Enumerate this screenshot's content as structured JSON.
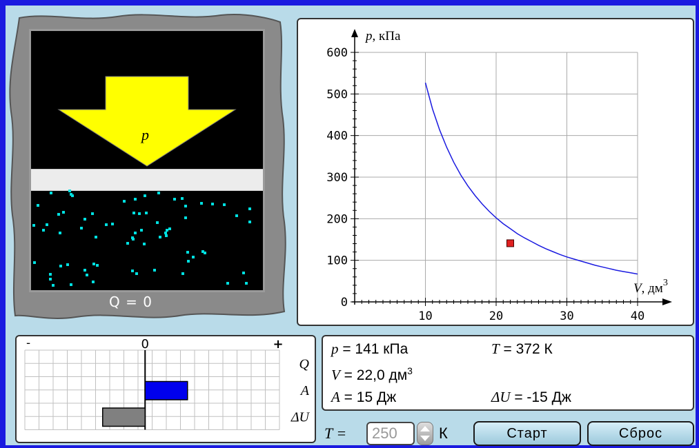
{
  "cylinder": {
    "arrow_label": "p",
    "heat_label": "Q = 0",
    "piston_level": 0.56
  },
  "graph": {
    "y_axis_label": "p, кПа",
    "x_axis_label_main": "V, дм",
    "x_axis_label_sup": "3",
    "colors": {
      "curve": "#1a1ae0",
      "marker": "#e02020"
    }
  },
  "chart_data": {
    "type": "line",
    "x_label": "V, дм3",
    "y_label": "p, кПа",
    "xlim": [
      0,
      40
    ],
    "ylim": [
      0,
      600
    ],
    "x_ticks": [
      10,
      20,
      30,
      40
    ],
    "y_ticks": [
      0,
      100,
      200,
      300,
      400,
      500,
      600
    ],
    "grid": true,
    "series": [
      {
        "x": [
          10,
          11,
          12,
          13,
          14,
          15,
          16,
          17,
          18,
          19,
          20,
          21,
          22,
          23,
          24,
          25,
          26,
          27,
          28,
          29,
          30,
          31,
          32,
          33,
          34,
          35,
          36,
          37,
          38,
          39,
          40
        ],
        "y": [
          527,
          464,
          414,
          372,
          336,
          305,
          279,
          256,
          236,
          218,
          202,
          188,
          176,
          164,
          154,
          145,
          136,
          128,
          121,
          114,
          108,
          103,
          98,
          93,
          88,
          84,
          80,
          76,
          73,
          70,
          67
        ]
      }
    ],
    "marker": {
      "x": 22,
      "y": 141
    }
  },
  "energy": {
    "scale_minus": "-",
    "scale_zero": "0",
    "scale_plus": "+",
    "rows": [
      {
        "label": "Q",
        "value": 0
      },
      {
        "label": "A",
        "value": 15
      },
      {
        "label": "ΔU",
        "value": -15
      }
    ],
    "colors": {
      "A": "#0000ee",
      "dU": "#808080"
    }
  },
  "readout": {
    "p_sym": "p",
    "p_val": " = 141 кПа",
    "T_sym": "T",
    "T_val": " = 372 К",
    "V_sym": "V",
    "V_val": " = 22,0 дм",
    "V_sup": "3",
    "A_sym": "A",
    "A_val": " =  15 Дж",
    "dU_sym": "ΔU",
    "dU_val": " =  -15 Дж"
  },
  "controls": {
    "t_label": "T =",
    "t_value": "250",
    "t_unit": "К",
    "start_label": "Старт",
    "reset_label": "Сброс"
  }
}
